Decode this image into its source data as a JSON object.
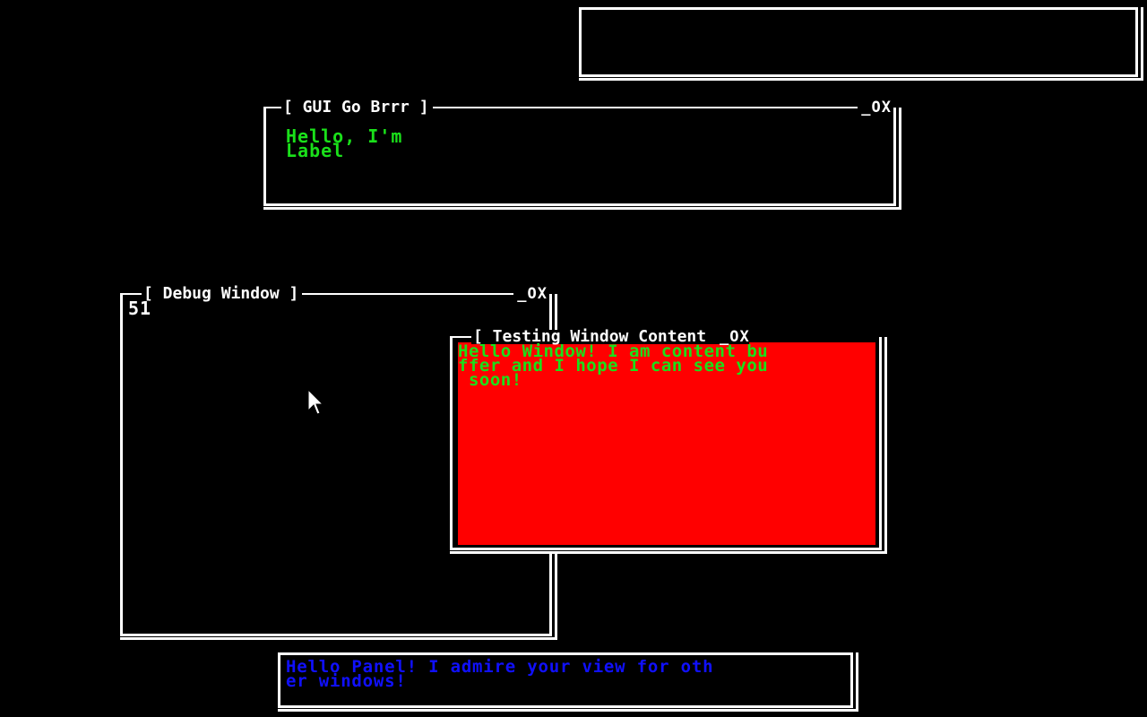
{
  "gui_window": {
    "title": "[ GUI Go Brrr ]",
    "minimize": "_",
    "maximize": "O",
    "close": "X",
    "label_line1": "Hello, I'm",
    "label_line2": "Label"
  },
  "debug_window": {
    "title": "[ Debug Window ]",
    "minimize": "_",
    "maximize": "O",
    "close": "X",
    "value": "51"
  },
  "testing_window": {
    "title": "[ Testing Window Content ",
    "minimize": "_",
    "maximize": "O",
    "close": "X",
    "line1": "Hello Window! I am content bu",
    "line2": "ffer and I hope I can see you",
    "line3": " soon!"
  },
  "panel": {
    "line1": "Hello Panel! I admire your view for oth",
    "line2": "er windows!"
  },
  "colors": {
    "background": "#000000",
    "frame": "#ffffff",
    "label_text": "#1ae01a",
    "panel_text": "#1010ff",
    "content_bg": "#ff0000"
  },
  "icons": {
    "cursor": "arrow-cursor-icon"
  }
}
